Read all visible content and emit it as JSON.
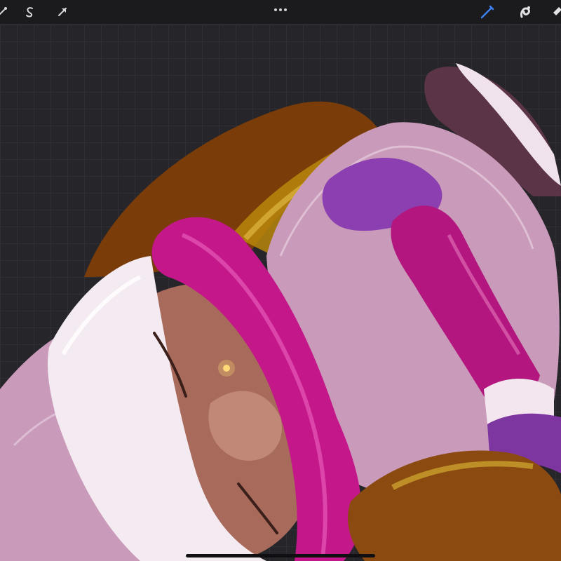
{
  "app": {
    "toolbar": {
      "left_tools": [
        {
          "icon": "adjustments-wand-icon"
        },
        {
          "icon": "selection-s-icon"
        },
        {
          "icon": "transform-arrow-icon"
        }
      ],
      "center": {
        "icon": "more-dots-icon"
      },
      "right_tools": [
        {
          "icon": "brush-icon",
          "active": true
        },
        {
          "icon": "smudge-icon"
        },
        {
          "icon": "eraser-icon"
        }
      ]
    },
    "colors": {
      "active_tool": "#3b82f6",
      "toolbar": "#1b1b1e",
      "canvas": "#25252a"
    }
  }
}
